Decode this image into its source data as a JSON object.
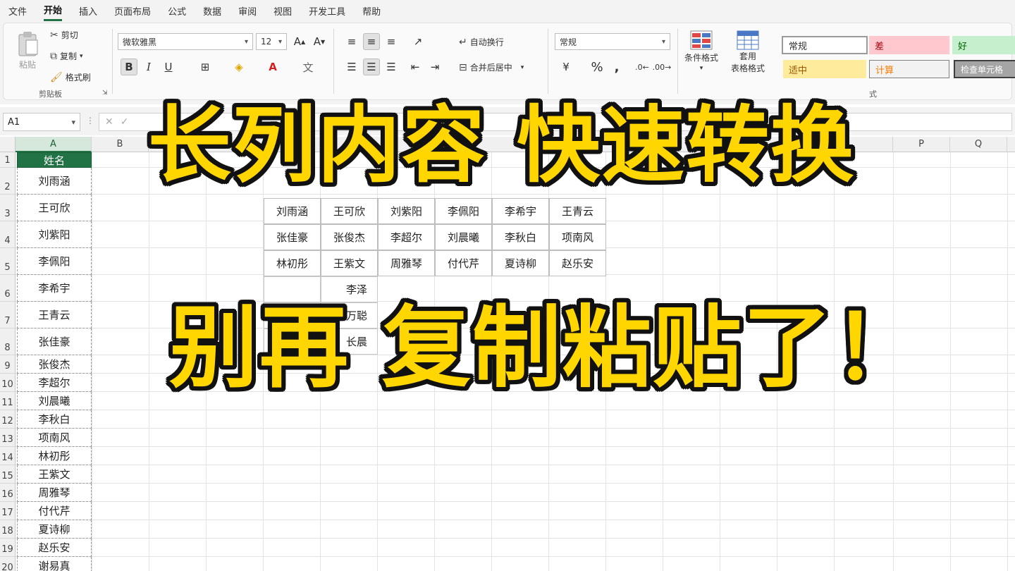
{
  "menu": [
    "文件",
    "开始",
    "插入",
    "页面布局",
    "公式",
    "数据",
    "审阅",
    "视图",
    "开发工具",
    "帮助"
  ],
  "menu_active_index": 1,
  "clipboard": {
    "paste": "粘贴",
    "cut": "剪切",
    "copy": "复制",
    "format_painter": "格式刷",
    "group": "剪贴板"
  },
  "font": {
    "name": "微软雅黑",
    "size": "12",
    "bold": "B",
    "italic": "I",
    "underline": "U"
  },
  "alignment": {
    "wrap": "自动换行",
    "merge": "合并后居中"
  },
  "number": {
    "format": "常规",
    "percent": "%",
    "comma": ","
  },
  "styles": {
    "conditional": "条件格式",
    "table_a": "套用",
    "table_b": "表格格式",
    "normal": "常规",
    "bad": "差",
    "good": "好",
    "neutral": "适中",
    "calc": "计算",
    "check": "检查单元格",
    "group_tail": "式"
  },
  "namebox": "A1",
  "columns": [
    "A",
    "B",
    "P",
    "Q"
  ],
  "rows": [
    "1",
    "2",
    "3",
    "4",
    "5",
    "6",
    "7",
    "8",
    "9",
    "10",
    "11",
    "12",
    "13",
    "14",
    "15",
    "16",
    "17",
    "18",
    "19",
    "20"
  ],
  "column_a": [
    "姓名",
    "刘雨涵",
    "王可欣",
    "刘紫阳",
    "李佩阳",
    "李希宇",
    "王青云",
    "张佳豪",
    "张俊杰",
    "李超尔",
    "刘晨曦",
    "李秋白",
    "项南风",
    "林初彤",
    "王紫文",
    "周雅琴",
    "付代芹",
    "夏诗柳",
    "赵乐安",
    "谢易真"
  ],
  "table_rows": [
    [
      "刘雨涵",
      "王可欣",
      "刘紫阳",
      "李佩阳",
      "李希宇",
      "王青云"
    ],
    [
      "张佳豪",
      "张俊杰",
      "李超尔",
      "刘晨曦",
      "李秋白",
      "项南风"
    ],
    [
      "林初彤",
      "王紫文",
      "周雅琴",
      "付代芹",
      "夏诗柳",
      "赵乐安"
    ]
  ],
  "partial_cells": [
    "李泽",
    "万聪",
    "长晨"
  ],
  "overlay": {
    "line1": "长列内容 快速转换",
    "line2": "别再 复制粘贴了！"
  },
  "colors": {
    "accent": "#217346",
    "title_fill": "#ffd600",
    "title_outline": "#111111"
  }
}
